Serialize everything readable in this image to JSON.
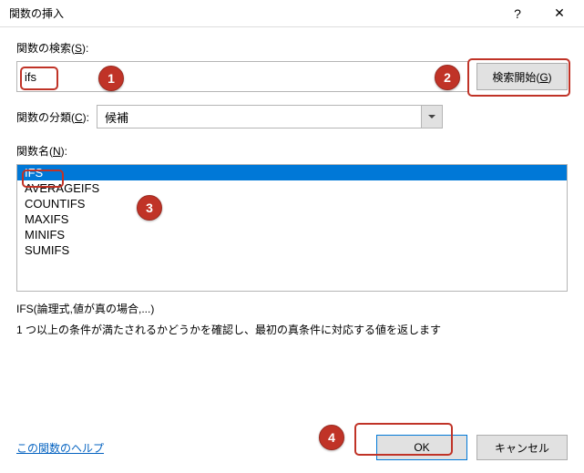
{
  "titlebar": {
    "title": "関数の挿入",
    "help": "?",
    "close": "✕"
  },
  "search": {
    "label_prefix": "関数の検索(",
    "label_key": "S",
    "label_suffix": "):",
    "value": "ifs",
    "button_prefix": "検索開始(",
    "button_key": "G",
    "button_suffix": ")"
  },
  "category": {
    "label_prefix": "関数の分類(",
    "label_key": "C",
    "label_suffix": "):",
    "value": "候補"
  },
  "funclist": {
    "label_prefix": "関数名(",
    "label_key": "N",
    "label_suffix": "):",
    "items": [
      "IFS",
      "AVERAGEIFS",
      "COUNTIFS",
      "MAXIFS",
      "MINIFS",
      "SUMIFS"
    ],
    "selected": "IFS"
  },
  "syntax": "IFS(論理式,値が真の場合,...)",
  "description": "1 つ以上の条件が満たされるかどうかを確認し、最初の真条件に対応する値を返します",
  "footer": {
    "help_link": "この関数のヘルプ",
    "ok": "OK",
    "cancel": "キャンセル"
  },
  "annotations": {
    "1": "1",
    "2": "2",
    "3": "3",
    "4": "4"
  }
}
